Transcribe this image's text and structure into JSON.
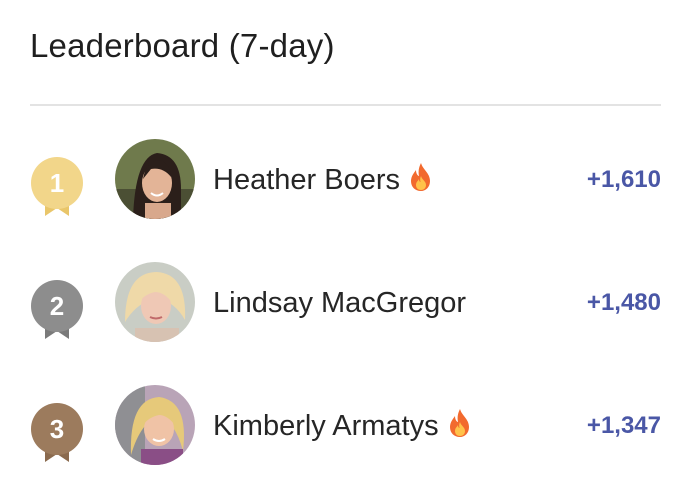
{
  "leaderboard": {
    "title": "Leaderboard (7-day)",
    "entries": [
      {
        "rank": "1",
        "name": "Heather Boers",
        "points": "+1,610",
        "streak_icon": "fire-icon",
        "medal_color": "#f2d68a",
        "avatar_bg": "#6f7a4c"
      },
      {
        "rank": "2",
        "name": "Lindsay MacGregor",
        "points": "+1,480",
        "streak_icon": null,
        "medal_color": "#8d8d8d",
        "avatar_bg": "#c9cdc5"
      },
      {
        "rank": "3",
        "name": "Kimberly Armatys",
        "points": "+1,347",
        "streak_icon": "fire-icon",
        "medal_color": "#9c7b5d",
        "avatar_bg": "#b9a4b7"
      }
    ]
  },
  "colors": {
    "points": "#4a57a6",
    "divider": "#e3e3e3",
    "fire": "#f26a2e"
  }
}
